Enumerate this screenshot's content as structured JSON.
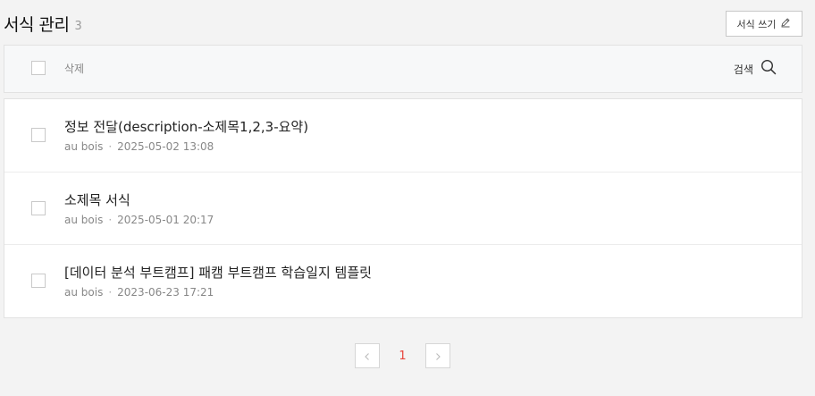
{
  "header": {
    "title": "서식 관리",
    "count": "3",
    "write_button": "서식 쓰기"
  },
  "toolbar": {
    "delete_label": "삭제",
    "search_label": "검색"
  },
  "templates": [
    {
      "title": "정보 전달(description-소제목1,2,3-요약)",
      "author": "au bois",
      "date": "2025-05-02 13:08"
    },
    {
      "title": "소제목 서식",
      "author": "au bois",
      "date": "2025-05-01 20:17"
    },
    {
      "title": "[데이터 분석 부트캠프] 패캠 부트캠프 학습일지 템플릿",
      "author": "au bois",
      "date": "2023-06-23 17:21"
    }
  ],
  "pagination": {
    "current_page": "1",
    "accent_color": "#e8453c"
  },
  "icons": [
    "pencil-icon",
    "search-icon",
    "chevron-left-icon",
    "chevron-right-icon"
  ]
}
